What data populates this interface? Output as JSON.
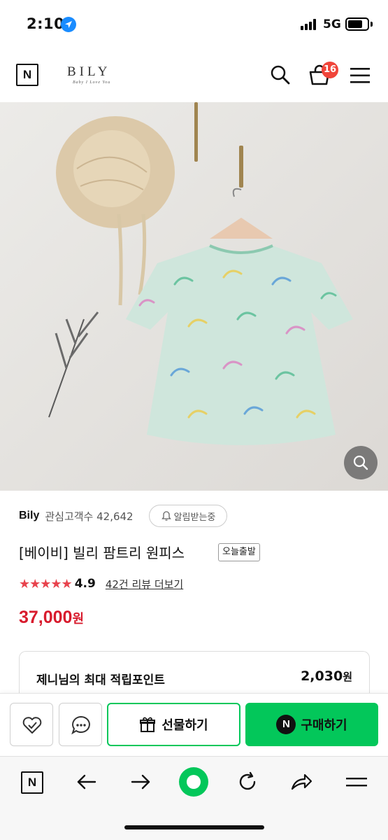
{
  "status_bar": {
    "time": "2:10",
    "network": "5G",
    "icons": [
      "location-arrow-icon",
      "signal-icon",
      "battery-icon"
    ]
  },
  "header": {
    "n_logo": "N",
    "brand_name": "BILY",
    "brand_tagline": "Baby I Love You",
    "icons": [
      "search-icon",
      "cart-icon",
      "menu-icon"
    ],
    "cart_count": "16"
  },
  "product": {
    "image_icon": "zoom-search-icon",
    "seller_name": "Bily",
    "followers_text": "관심고객수 42,642",
    "notify_label": "알림받는중",
    "title": "[베이비] 빌리 팜트리 원피스",
    "badge": "오늘출발",
    "stars": "★★★★★",
    "rating": "4.9",
    "review_link": "42건 리뷰 더보기",
    "price": "37,000",
    "price_unit": "원",
    "price_color": "#d81b2d"
  },
  "points": {
    "label": "제니님의 최대 적립포인트",
    "value": "2,030",
    "unit": "원"
  },
  "actions": {
    "gift_label": "선물하기",
    "buy_label": "구매하기",
    "npay_letter": "N",
    "accent_color": "#03c75a",
    "icons": [
      "heart-check-icon",
      "chat-icon",
      "gift-icon",
      "npay-icon"
    ]
  },
  "browser": {
    "n_logo": "N",
    "icons": [
      "n-home-icon",
      "back-arrow-icon",
      "forward-arrow-icon",
      "green-dot-icon",
      "refresh-icon",
      "share-icon",
      "menu-icon"
    ]
  }
}
